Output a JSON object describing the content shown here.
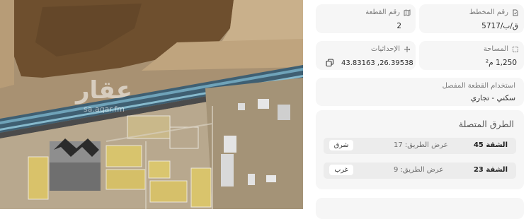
{
  "map": {
    "watermark_brand": "عقار",
    "watermark_url": "sa.aqar.fm"
  },
  "plan_number": {
    "label": "رقم المخطط",
    "value": "ق/ب/5717",
    "icon": "document-icon"
  },
  "plot_number": {
    "label": "رقم القطعة",
    "value": "2",
    "icon": "map-icon"
  },
  "area": {
    "label": "المساحة",
    "value": "1,250 م²",
    "icon": "area-icon"
  },
  "coordinates": {
    "label": "الإحداثيات",
    "value": "43.83163 ,26.39538",
    "icon": "coordinates-icon",
    "copy_icon": "copy-icon"
  },
  "land_use": {
    "label": "استخدام القطعة المفصل",
    "value": "سكني - تجاري"
  },
  "connected_roads": {
    "title": "الطرق المتصلة",
    "rows": [
      {
        "name": "الشقة 45",
        "width": "عرض الطريق: 17",
        "direction": "شرق"
      },
      {
        "name": "الشقة 23",
        "width": "عرض الطريق: 9",
        "direction": "غرب"
      }
    ]
  }
}
